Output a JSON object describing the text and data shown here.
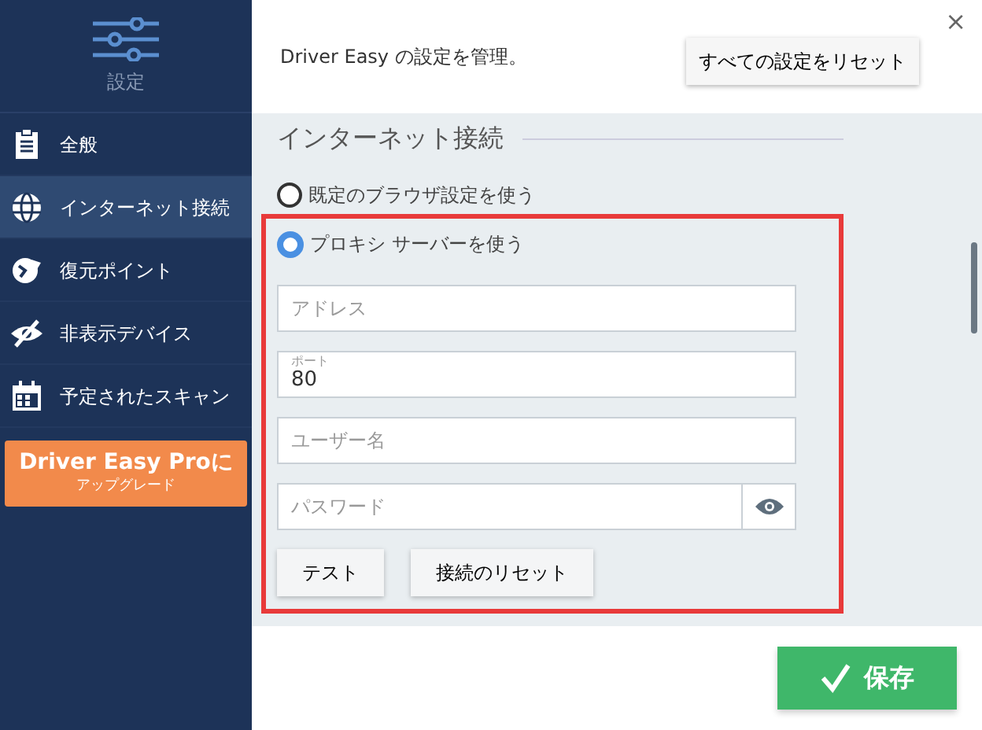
{
  "sidebar": {
    "title": "設定",
    "items": [
      {
        "label": "全般",
        "selected": false
      },
      {
        "label": "インターネット接続",
        "selected": true
      },
      {
        "label": "復元ポイント",
        "selected": false
      },
      {
        "label": "非表示デバイス",
        "selected": false
      },
      {
        "label": "予定されたスキャン",
        "selected": false
      }
    ],
    "upgrade": {
      "title": "Driver Easy Proに",
      "subtitle": "アップグレード"
    }
  },
  "header": {
    "text": "Driver Easy の設定を管理。",
    "reset_button": "すべての設定をリセット",
    "close": "×"
  },
  "section_title": "インターネット接続",
  "options": [
    {
      "label": "既定のブラウザ設定を使う",
      "selected": false
    },
    {
      "label": "プロキシ サーバーを使う",
      "selected": true
    }
  ],
  "fields": [
    {
      "kind": "text",
      "placeholder": "アドレス"
    },
    {
      "kind": "floating",
      "label": "ポート",
      "value": "80"
    },
    {
      "kind": "text",
      "placeholder": "ユーザー名"
    },
    {
      "kind": "password",
      "placeholder": "パスワード"
    }
  ],
  "buttons": [
    "テスト",
    "接続のリセット"
  ],
  "save_button": "保存"
}
